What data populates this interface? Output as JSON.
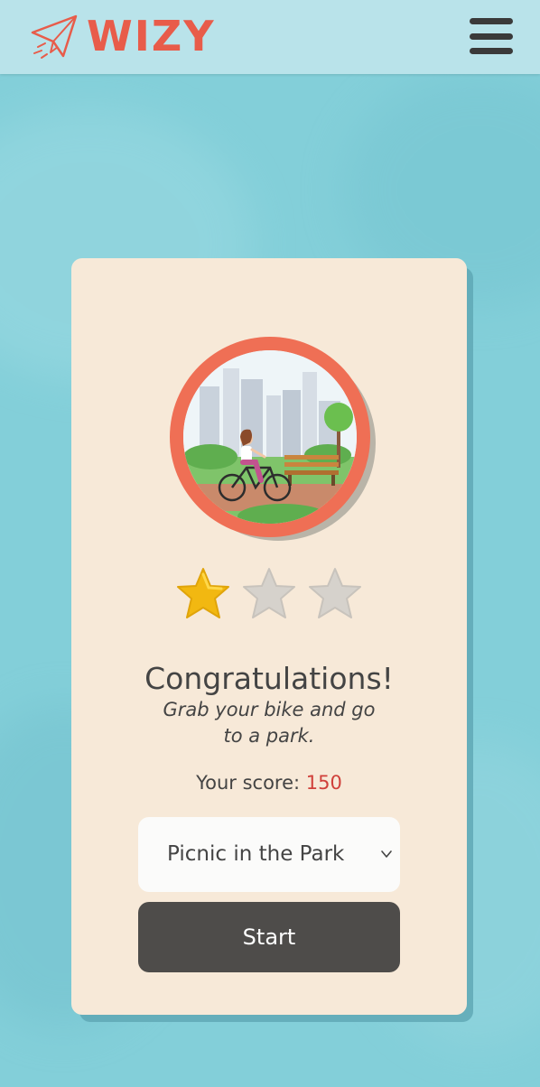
{
  "app": {
    "name": "WIZY",
    "brand_color": "#e85c4a",
    "background_color": "#83cfd9"
  },
  "header": {
    "logo_icon": "paper-plane-icon",
    "menu_icon": "hamburger-menu-icon"
  },
  "result": {
    "badge_illustration": "park-cyclist-illustration",
    "stars_total": 3,
    "stars_earned": 1,
    "title": "Congratulations!",
    "subtitle": "Grab your bike and go to a park.",
    "score_label": "Your score:",
    "score_value": "150",
    "score_color": "#d0403a"
  },
  "controls": {
    "selected_option": "Picnic in the Park",
    "start_label": "Start"
  }
}
